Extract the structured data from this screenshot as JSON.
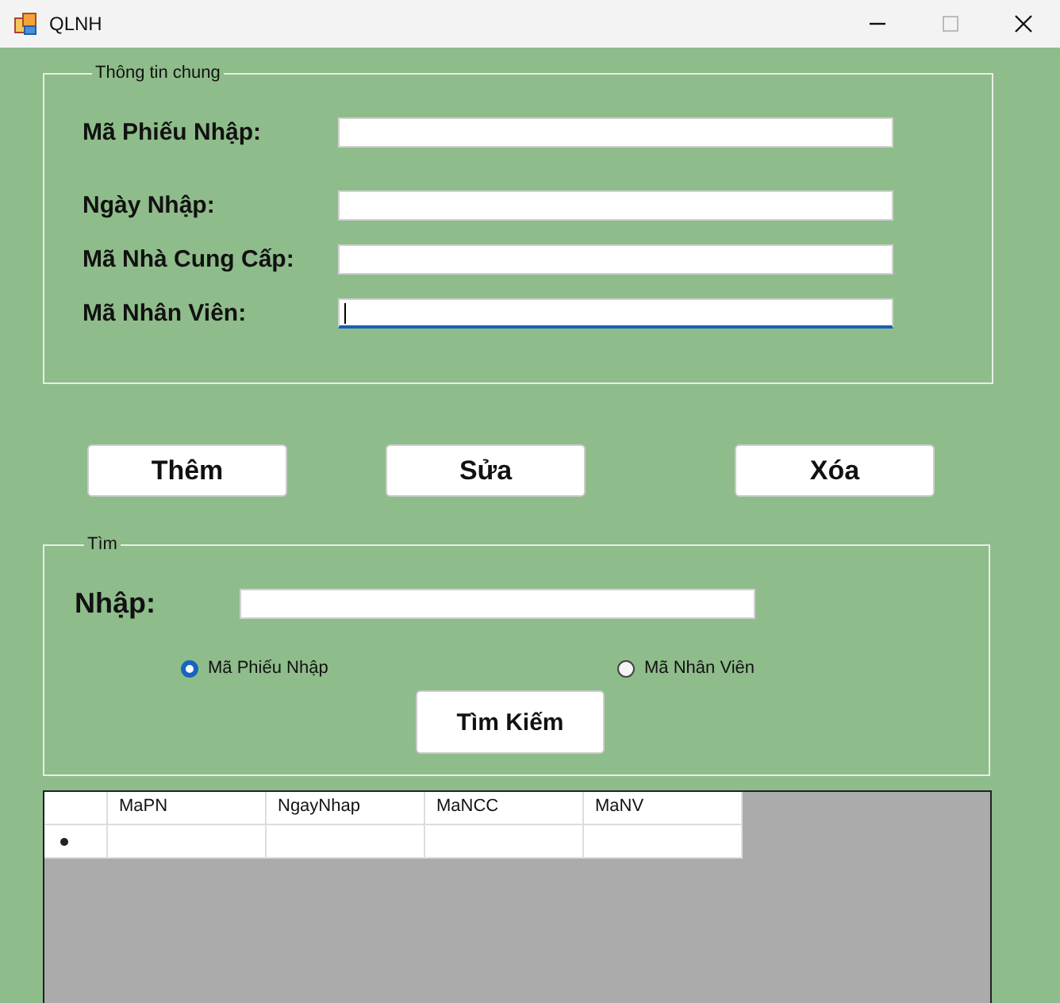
{
  "window": {
    "title": "QLNH"
  },
  "general_group": {
    "title": "Thông tin chung",
    "fields": [
      {
        "label": "Mã Phiếu Nhập:",
        "focused": false
      },
      {
        "label": "Ngày Nhập:",
        "focused": false
      },
      {
        "label": "Mã Nhà Cung Cấp:",
        "focused": false
      },
      {
        "label": "Mã Nhân Viên:",
        "focused": true
      }
    ]
  },
  "buttons": [
    "Thêm",
    "Sửa",
    "Xóa"
  ],
  "search_group": {
    "title": "Tìm",
    "input_label": "Nhập:",
    "options": [
      {
        "label": "Mã Phiếu Nhập",
        "selected": true
      },
      {
        "label": "Mã Nhân Viên",
        "selected": false
      }
    ],
    "search_button": "Tìm Kiếm"
  },
  "grid": {
    "columns": [
      "MaPN",
      "NgayNhap",
      "MaNCC",
      "MaNV"
    ]
  }
}
